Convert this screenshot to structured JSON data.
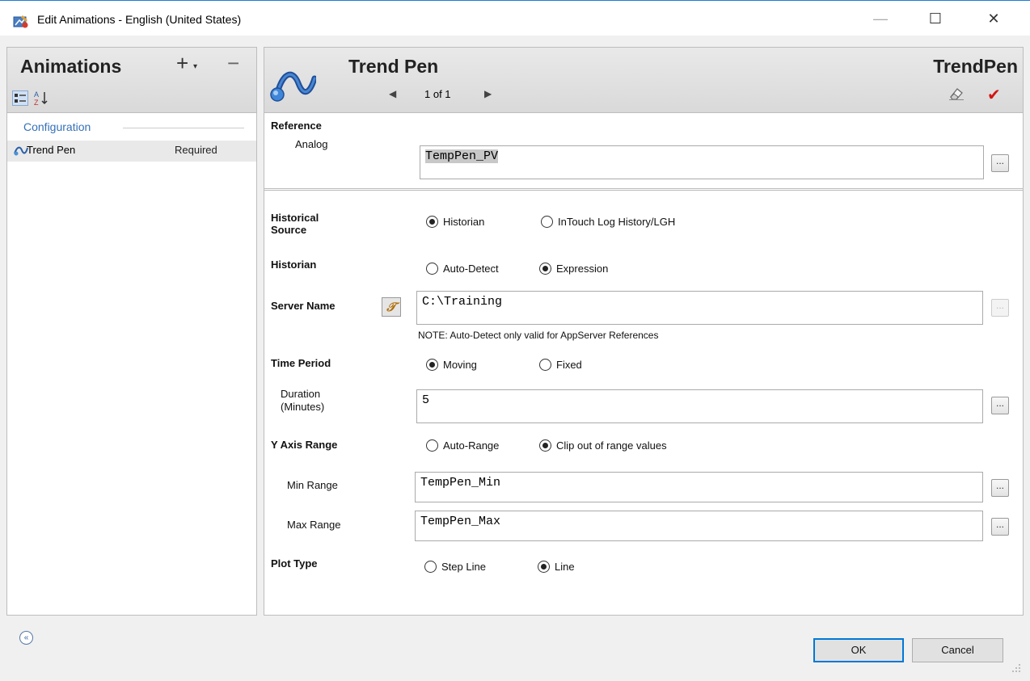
{
  "window": {
    "title": "Edit Animations - English (United States)",
    "minimize_symbol": "—",
    "maximize_symbol": "☐",
    "close_symbol": "✕"
  },
  "left_panel": {
    "title": "Animations",
    "add_symbol": "+",
    "add_dropdown_symbol": "▾",
    "remove_symbol": "−",
    "sort_icons": [
      "categorized-icon",
      "sort-alpha-icon"
    ],
    "group_label": "Configuration",
    "items": [
      {
        "name": "Trend Pen",
        "status": "Required",
        "icon": "trend-pen-icon"
      }
    ]
  },
  "right_panel": {
    "animation_title": "Trend Pen",
    "type_name": "TrendPen",
    "nav": {
      "prev": "◀",
      "page": "1 of 1",
      "next": "▶"
    },
    "check_symbol": "✔",
    "reference": {
      "section_label": "Reference",
      "analog_label": "Analog",
      "analog_value": "TempPen_PV"
    },
    "historical_source": {
      "label": "Historical\nSource",
      "label_line1": "Historical",
      "label_line2": "Source",
      "options": [
        "Historian",
        "InTouch Log History/LGH"
      ],
      "selected": "Historian"
    },
    "historian": {
      "label": "Historian",
      "options": [
        "Auto-Detect",
        "Expression"
      ],
      "selected": "Expression"
    },
    "server_name": {
      "label": "Server Name",
      "expression_symbol": "𝒯",
      "value": "C:\\Training",
      "note": "NOTE: Auto-Detect only valid for AppServer References"
    },
    "time_period": {
      "label": "Time Period",
      "options": [
        "Moving",
        "Fixed"
      ],
      "selected": "Moving"
    },
    "duration": {
      "label_line1": "Duration",
      "label_line2": "(Minutes)",
      "value": "5"
    },
    "y_axis_range": {
      "label": "Y Axis Range",
      "options": [
        "Auto-Range",
        "Clip out of range values"
      ],
      "selected": "Clip out of range values"
    },
    "min_range": {
      "label": "Min Range",
      "value": "TempPen_Min"
    },
    "max_range": {
      "label": "Max Range",
      "value": "TempPen_Max"
    },
    "plot_type": {
      "label": "Plot Type",
      "options": [
        "Step Line",
        "Line"
      ],
      "selected": "Line"
    },
    "browse_label": "..."
  },
  "footer": {
    "collapse_symbol": "«",
    "ok_label": "OK",
    "cancel_label": "Cancel"
  },
  "colors": {
    "accent": "#0078d7",
    "group_label": "#3570b8",
    "check": "#d41414"
  }
}
